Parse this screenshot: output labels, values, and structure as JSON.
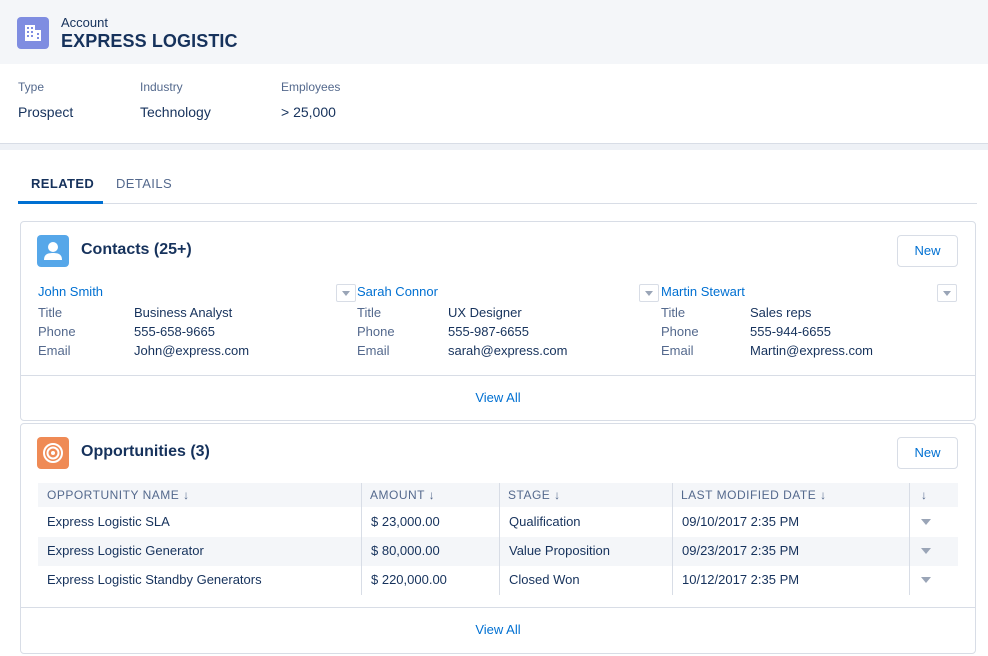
{
  "header": {
    "object_label": "Account",
    "record_name": "EXPRESS LOGISTIC",
    "icon": "building-icon",
    "icon_color": "#7f8de1"
  },
  "highlights": {
    "type_label": "Type",
    "type_value": "Prospect",
    "industry_label": "Industry",
    "industry_value": "Technology",
    "employees_label": "Employees",
    "employees_value": "> 25,000"
  },
  "tabs": {
    "related": "RELATED",
    "details": "DETAILS",
    "active": "RELATED"
  },
  "contacts": {
    "title": "Contacts (25+)",
    "icon": "contact-icon",
    "icon_color": "#56a7e9",
    "new_label": "New",
    "view_all": "View All",
    "field_labels": {
      "title": "Title",
      "phone": "Phone",
      "email": "Email"
    },
    "items": [
      {
        "name": "John Smith",
        "title": "Business Analyst",
        "phone": "555-658-9665",
        "email": "John@express.com"
      },
      {
        "name": "Sarah Connor",
        "title": "UX Designer",
        "phone": "555-987-6655",
        "email": "sarah@express.com"
      },
      {
        "name": "Martin Stewart",
        "title": "Sales reps",
        "phone": "555-944-6655",
        "email": "Martin@express.com"
      }
    ]
  },
  "opportunities": {
    "title": "Opportunities (3)",
    "icon": "target-icon",
    "icon_color": "#ef8a55",
    "new_label": "New",
    "view_all": "View All",
    "columns": [
      "OPPORTUNITY NAME",
      "AMOUNT",
      "STAGE",
      "LAST MODIFIED DATE"
    ],
    "sort_glyph": "↓",
    "rows": [
      {
        "name": "Express Logistic SLA",
        "amount": "$ 23,000.00",
        "stage": "Qualification",
        "modified": "09/10/2017 2:35 PM"
      },
      {
        "name": "Express Logistic Generator",
        "amount": "$ 80,000.00",
        "stage": "Value Proposition",
        "modified": "09/23/2017 2:35 PM"
      },
      {
        "name": "Express Logistic Standby Generators",
        "amount": "$ 220,000.00",
        "stage": "Closed Won",
        "modified": "10/12/2017 2:35 PM"
      }
    ]
  },
  "colors": {
    "link": "#0070d2",
    "text": "#16325c",
    "muted": "#54698d",
    "border": "#d8dde6"
  }
}
